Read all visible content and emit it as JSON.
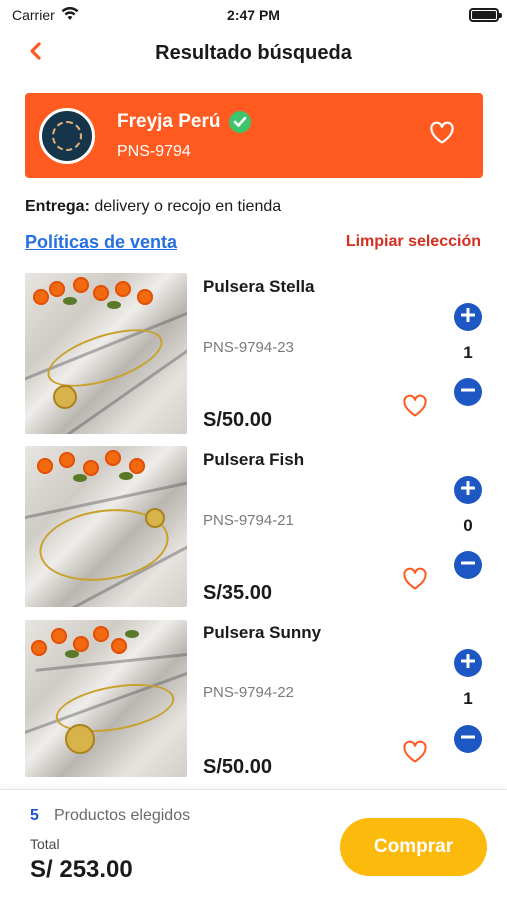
{
  "status_bar": {
    "carrier": "Carrier",
    "time": "2:47 PM"
  },
  "nav": {
    "title": "Resultado búsqueda",
    "back_icon": "chevron-left-icon"
  },
  "store": {
    "name": "Freyja Perú",
    "code": "PNS-9794",
    "verified_icon": "check-circle-icon",
    "favorite_icon": "heart-outline-icon"
  },
  "delivery": {
    "label": "Entrega:",
    "value": "delivery o recojo en tienda"
  },
  "links": {
    "policies": "Políticas de venta",
    "clear_selection": "Limpiar selección"
  },
  "products": [
    {
      "name": "Pulsera Stella",
      "code": "PNS-9794-23",
      "price": "S/50.00",
      "quantity": "1"
    },
    {
      "name": "Pulsera Fish",
      "code": "PNS-9794-21",
      "price": "S/35.00",
      "quantity": "0"
    },
    {
      "name": "Pulsera Sunny",
      "code": "PNS-9794-22",
      "price": "S/50.00",
      "quantity": "1"
    }
  ],
  "footer": {
    "count": "5",
    "count_label": "Productos elegidos",
    "total_label": "Total",
    "total": "S/ 253.00",
    "buy_label": "Comprar"
  },
  "colors": {
    "brand_orange": "#ff5a1f",
    "link_blue": "#2470e0",
    "action_blue": "#1d57c4",
    "clear_red": "#d62f1f",
    "buy_yellow": "#fcba0c",
    "verified_green": "#3ec46d"
  }
}
